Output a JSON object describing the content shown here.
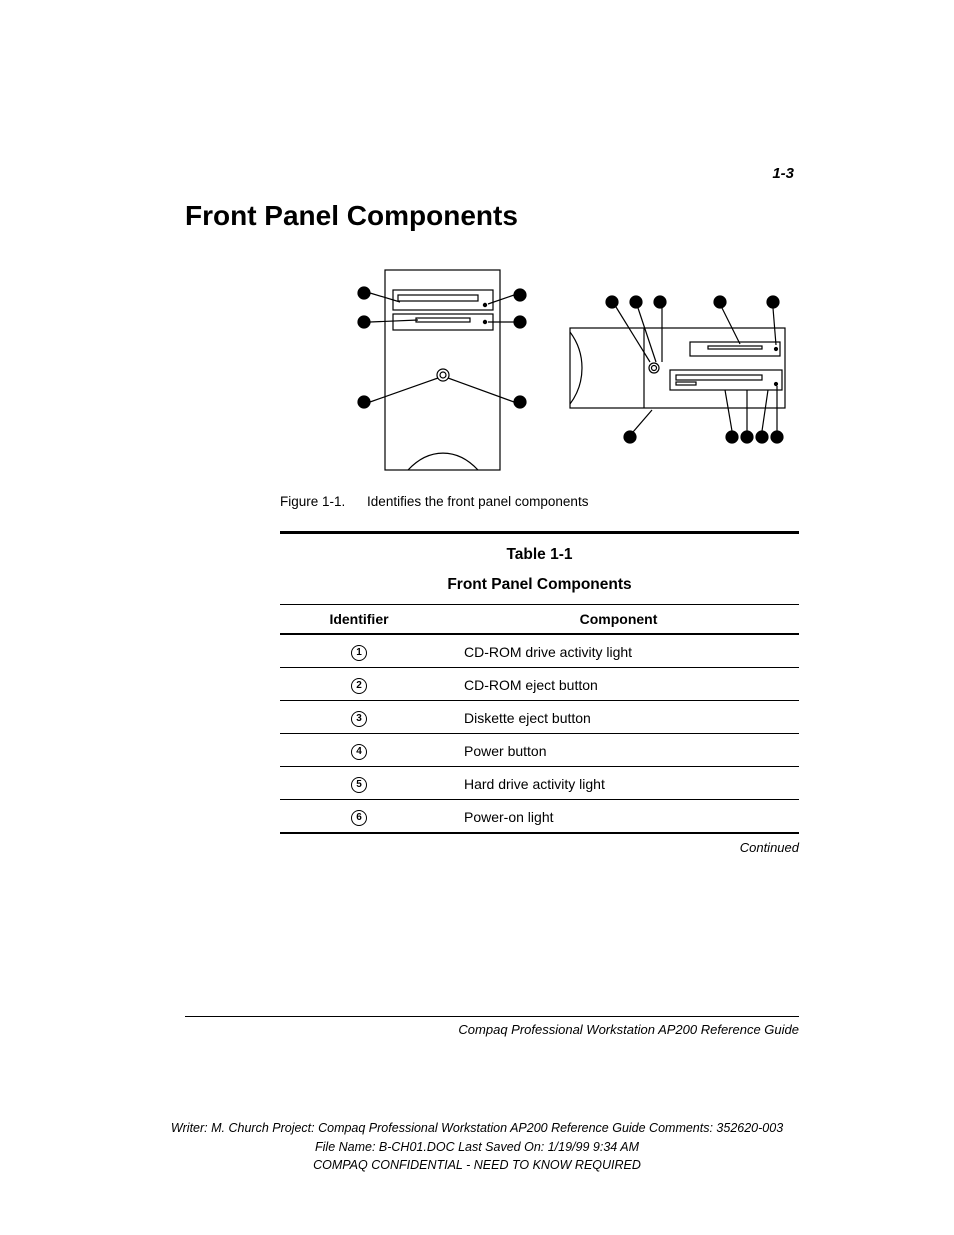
{
  "page_number": "1-3",
  "heading": "Front Panel Components",
  "figure": {
    "label": "Figure 1-1.",
    "caption": "Identifies the front panel components"
  },
  "table": {
    "number": "Table 1-1",
    "title": "Front Panel Components",
    "col_identifier": "Identifier",
    "col_component": "Component",
    "rows": [
      {
        "id": "1",
        "component": "CD-ROM drive activity light"
      },
      {
        "id": "2",
        "component": "CD-ROM eject button"
      },
      {
        "id": "3",
        "component": "Diskette eject button"
      },
      {
        "id": "4",
        "component": "Power button"
      },
      {
        "id": "5",
        "component": "Hard drive activity light"
      },
      {
        "id": "6",
        "component": "Power-on light"
      }
    ],
    "continued": "Continued"
  },
  "footer_guide": "Compaq Professional Workstation AP200 Reference Guide",
  "footer_meta": {
    "line1": "Writer: M. Church   Project: Compaq Professional Workstation AP200 Reference Guide   Comments: 352620-003",
    "line2": "File Name: B-CH01.DOC   Last Saved On: 1/19/99 9:34 AM",
    "line3": "COMPAQ CONFIDENTIAL - NEED TO KNOW REQUIRED"
  }
}
